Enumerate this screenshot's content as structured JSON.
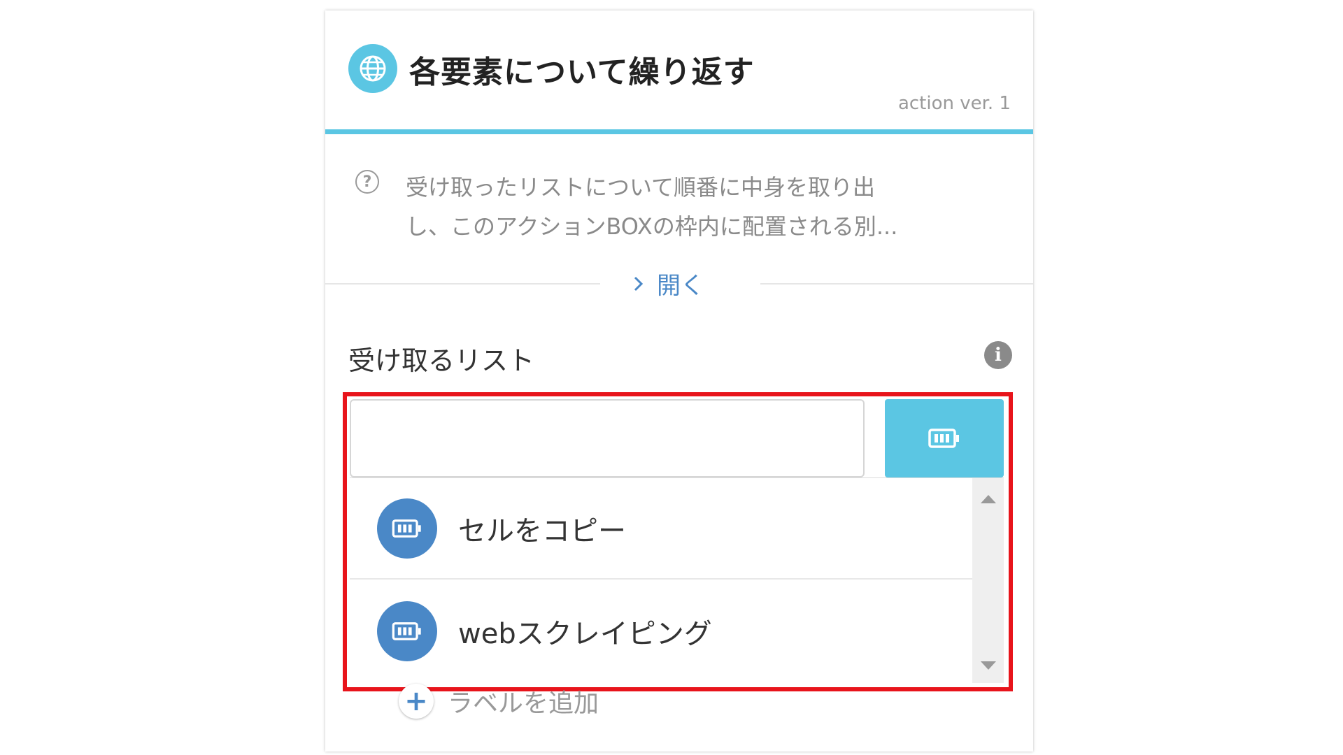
{
  "action": {
    "title": "各要素について繰り返す",
    "version": "action ver. 1",
    "icon": "globe-icon",
    "accent_color": "#5bc6e3"
  },
  "description": {
    "line1": "受け取ったリストについて順番に中身を取り出",
    "line2": "し、このアクションBOXの枠内に配置される別...",
    "toggle_label": "開く"
  },
  "field": {
    "label": "受け取るリスト",
    "value": "",
    "picker_icon": "variable-icon"
  },
  "dropdown": {
    "items": [
      {
        "label": "セルをコピー",
        "icon": "variable-icon"
      },
      {
        "label": "webスクレイピング",
        "icon": "variable-icon"
      }
    ]
  },
  "footer": {
    "add_label": "ラベルを追加"
  },
  "highlight_color": "#e8141b"
}
